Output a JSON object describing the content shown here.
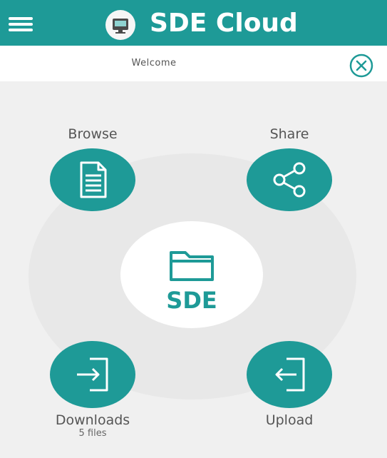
{
  "header": {
    "title": "SDE Cloud",
    "menu_icon": "hamburger-menu-icon",
    "logo_icon": "cloud-drive-logo-icon"
  },
  "welcome": {
    "text": "Welcome",
    "close_icon": "close-circle-icon"
  },
  "actions": {
    "browse": {
      "label": "Browse",
      "icon": "document-icon"
    },
    "share": {
      "label": "Share",
      "icon": "share-icon"
    },
    "downloads": {
      "label": "Downloads",
      "sublabel": "5 files",
      "icon": "download-icon"
    },
    "upload": {
      "label": "Upload",
      "icon": "upload-icon"
    }
  },
  "center": {
    "label": "SDE",
    "icon": "folder-icon"
  },
  "colors": {
    "accent": "#1e9a97",
    "background": "#f0f0f0",
    "ring": "#e8e8e8",
    "white": "#ffffff"
  }
}
